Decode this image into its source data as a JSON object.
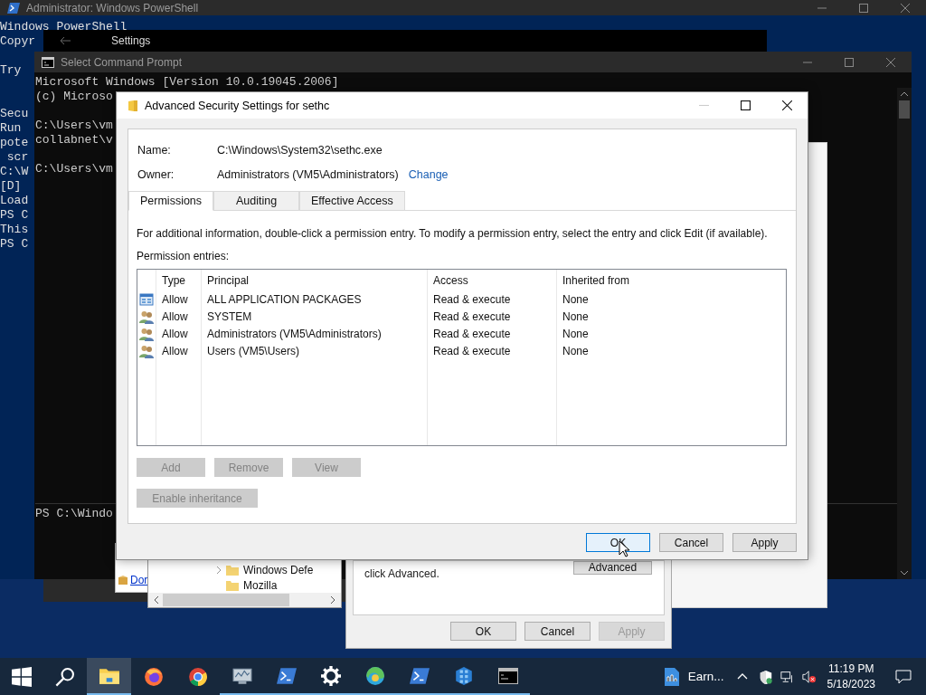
{
  "powershell": {
    "title": "Administrator: Windows PowerShell",
    "blocks": [
      [
        "Windows PowerShell",
        "Copyr"
      ],
      [
        "Try"
      ],
      [
        "Secu",
        "Run",
        "pote",
        " scr",
        "C:\\W",
        "[D]",
        "Load",
        "PS C",
        "This",
        "PS C"
      ]
    ]
  },
  "settings_window": {
    "title": "Settings"
  },
  "command_prompt": {
    "title": "Select Command Prompt",
    "blocks": [
      [
        "Microsoft Windows [Version 10.0.19045.2006]",
        "(c) Microso"
      ],
      [
        "C:\\Users\\vm",
        "collabnet\\v"
      ],
      [
        "C:\\Users\\vm"
      ]
    ],
    "bottom_line": "PS C:\\Windo"
  },
  "link_window": {
    "link": "Dor"
  },
  "explorer_tree": {
    "items": [
      {
        "label": "Windows Defe",
        "expandable": true
      },
      {
        "label": "Mozilla",
        "expandable": false
      }
    ]
  },
  "properties_dialog": {
    "note": "click Advanced.",
    "advanced_button": "Advanced",
    "buttons": [
      {
        "label": "OK",
        "disabled": false
      },
      {
        "label": "Cancel",
        "disabled": false
      },
      {
        "label": "Apply",
        "disabled": true
      }
    ]
  },
  "dialog": {
    "title": "Advanced Security Settings for sethc",
    "name_label": "Name:",
    "name_value": "C:\\Windows\\System32\\sethc.exe",
    "owner_label": "Owner:",
    "owner_value": "Administrators (VM5\\Administrators)",
    "change_link": "Change",
    "tabs": [
      {
        "label": "Permissions",
        "selected": true
      },
      {
        "label": "Auditing",
        "selected": false
      },
      {
        "label": "Effective Access",
        "selected": false
      }
    ],
    "info": "For additional information, double-click a permission entry. To modify a permission entry, select the entry and click Edit (if available).",
    "entries_label": "Permission entries:",
    "columns": [
      "Type",
      "Principal",
      "Access",
      "Inherited from"
    ],
    "rows": [
      {
        "kind": "package",
        "type": "Allow",
        "principal": "ALL APPLICATION PACKAGES",
        "access": "Read & execute",
        "inherited_from": "None"
      },
      {
        "kind": "group",
        "type": "Allow",
        "principal": "SYSTEM",
        "access": "Read & execute",
        "inherited_from": "None"
      },
      {
        "kind": "group",
        "type": "Allow",
        "principal": "Administrators (VM5\\Administrators)",
        "access": "Read & execute",
        "inherited_from": "None"
      },
      {
        "kind": "group",
        "type": "Allow",
        "principal": "Users (VM5\\Users)",
        "access": "Read & execute",
        "inherited_from": "None"
      }
    ],
    "entry_buttons": [
      {
        "label": "Add",
        "disabled": true
      },
      {
        "label": "Remove",
        "disabled": true
      },
      {
        "label": "View",
        "disabled": true
      }
    ],
    "inheritance_button": {
      "label": "Enable inheritance",
      "disabled": true
    },
    "footer_buttons": [
      {
        "label": "OK",
        "focused": true
      },
      {
        "label": "Cancel",
        "focused": false
      },
      {
        "label": "Apply",
        "focused": false
      }
    ]
  },
  "taskbar": {
    "apps": [
      {
        "kind": "folder",
        "active": true,
        "running": true
      },
      {
        "kind": "firefox",
        "active": false,
        "running": false
      },
      {
        "kind": "chrome",
        "active": false,
        "running": false
      },
      {
        "kind": "monitor",
        "active": false,
        "running": true
      },
      {
        "kind": "prompt",
        "active": false,
        "running": true
      },
      {
        "kind": "gear",
        "active": false,
        "running": true
      },
      {
        "kind": "edge",
        "active": false,
        "running": true
      },
      {
        "kind": "prompt",
        "active": false,
        "running": true
      },
      {
        "kind": "cubes",
        "active": false,
        "running": true
      },
      {
        "kind": "terminal",
        "active": false,
        "running": true
      }
    ],
    "pinned_file": "Earn...",
    "time": "11:19 PM",
    "date": "5/18/2023"
  }
}
